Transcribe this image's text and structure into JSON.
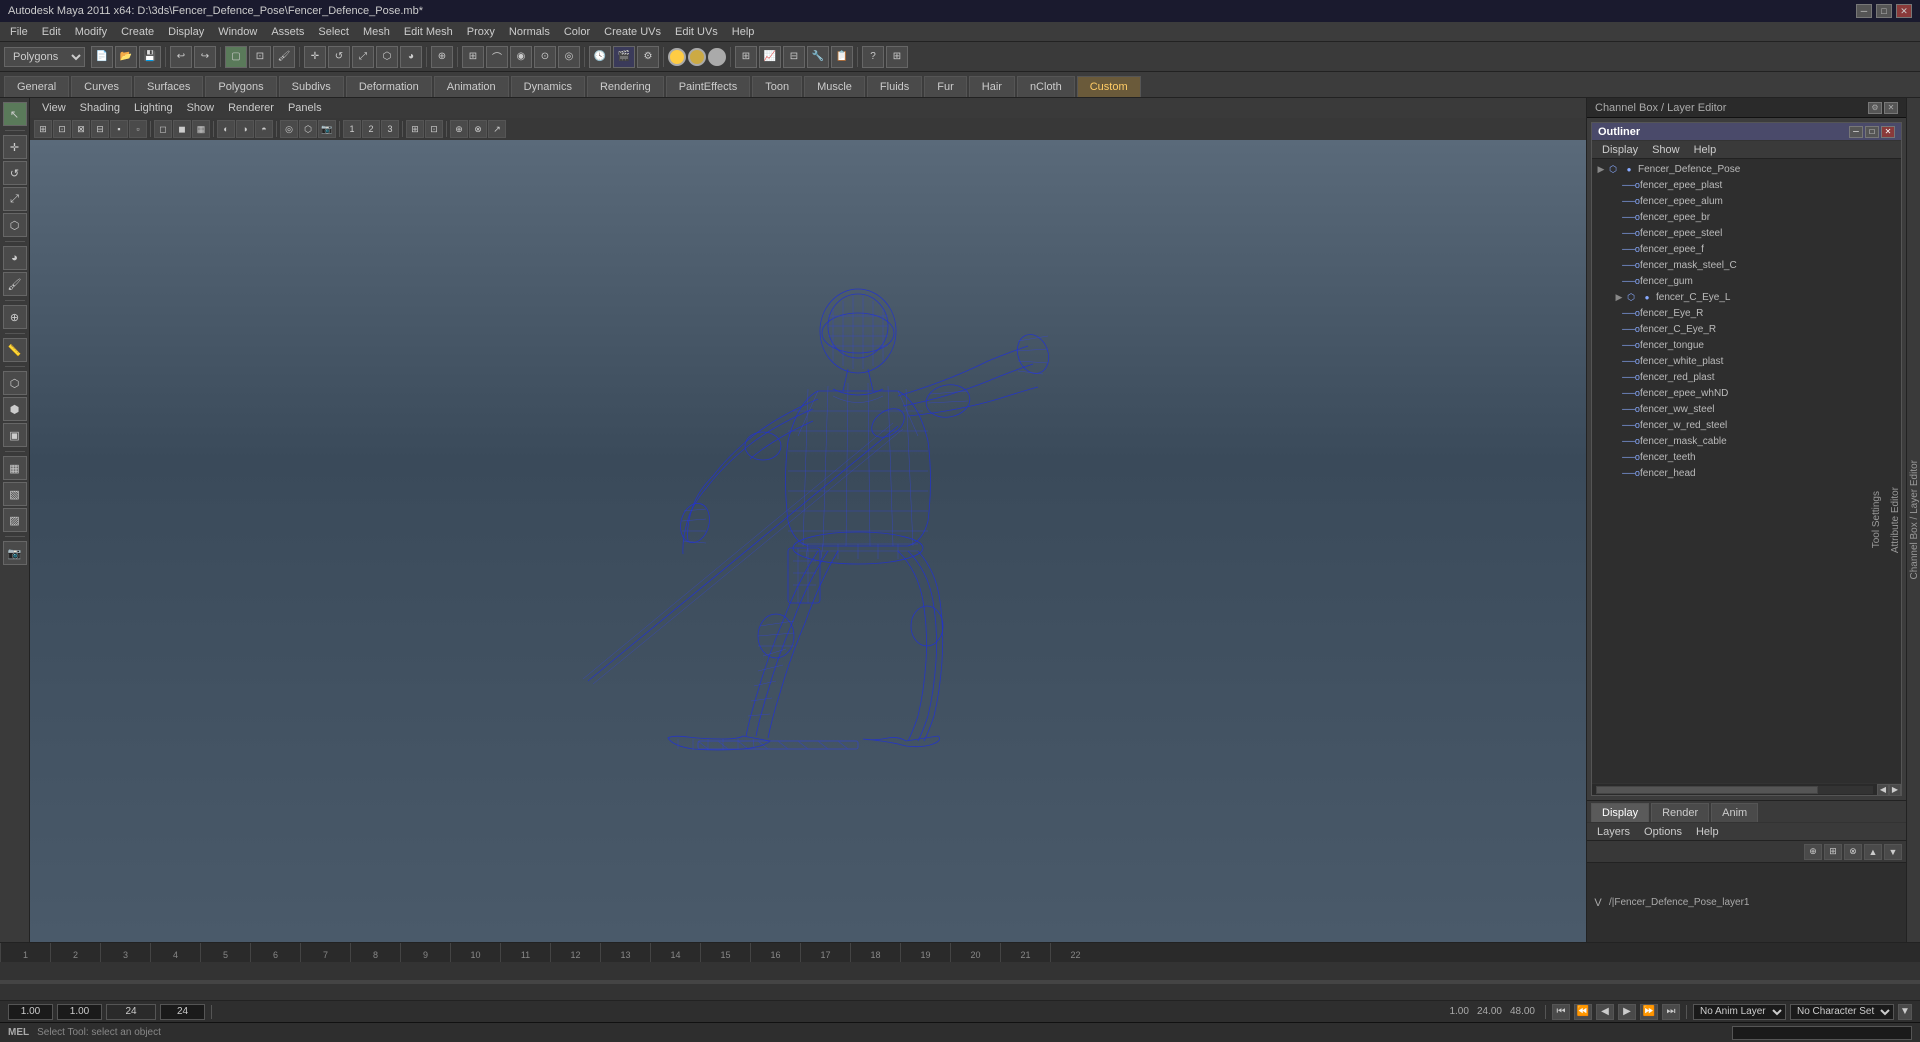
{
  "title_bar": {
    "title": "Autodesk Maya 2011 x64: D:\\3ds\\Fencer_Defence_Pose\\Fencer_Defence_Pose.mb*",
    "min_btn": "─",
    "max_btn": "□",
    "close_btn": "✕"
  },
  "menu_bar": {
    "items": [
      "File",
      "Edit",
      "Modify",
      "Create",
      "Display",
      "Window",
      "Assets",
      "Select",
      "Mesh",
      "Edit Mesh",
      "Proxy",
      "Normals",
      "Color",
      "Create UVs",
      "Edit UVs",
      "Help"
    ]
  },
  "workspace_select": "Polygons",
  "toolbar": {
    "buttons": [
      "⟳",
      "📁",
      "💾",
      "✦",
      "↩",
      "↪",
      "🔧",
      "⚙",
      "🔲",
      "⊞",
      "⊡",
      "△",
      "▽",
      "◁",
      "▷",
      "⬡",
      "⬢",
      "✂",
      "📋",
      "🗑",
      "🔍",
      "🔎",
      "⊕",
      "⊗",
      "↗",
      "↙",
      "⤢",
      "⤡",
      "🎯",
      "◉",
      "⊙",
      "◎",
      "●",
      "○",
      "◐",
      "◑",
      "◒",
      "◓",
      "⬤",
      "▣",
      "▤",
      "▥",
      "▦",
      "▧",
      "▨",
      "▩"
    ]
  },
  "tabs": {
    "items": [
      "General",
      "Curves",
      "Surfaces",
      "Polygons",
      "Subdivs",
      "Deformation",
      "Animation",
      "Dynamics",
      "Rendering",
      "PaintEffects",
      "Toon",
      "Muscle",
      "Fluids",
      "Fur",
      "Hair",
      "nCloth",
      "Custom"
    ]
  },
  "viewport_menu": {
    "items": [
      "View",
      "Shading",
      "Lighting",
      "Show",
      "Renderer",
      "Panels"
    ]
  },
  "viewport_toolbar": {
    "buttons": [
      "⊞",
      "⊟",
      "⊠",
      "⊡",
      "▣",
      "⊕",
      "⬡",
      "⬢",
      "◉",
      "⊙",
      "◎",
      "◐",
      "◑",
      "⬛",
      "⬜",
      "▪",
      "▫",
      "◆",
      "◇",
      "▲",
      "△",
      "▼",
      "▽",
      "◀",
      "▶",
      "⊤",
      "⊥",
      "⋮",
      "⋯",
      "⊸",
      "⊹",
      "⊺",
      "⊻",
      "⊼",
      "⊽"
    ]
  },
  "channel_box": {
    "title": "Channel Box / Layer Editor"
  },
  "outliner": {
    "title": "Outliner",
    "menu": [
      "Display",
      "Show",
      "Help"
    ],
    "items": [
      {
        "name": "Fencer_Defence_Pose",
        "type": "group",
        "icon": "▶",
        "indent": 0,
        "selected": false
      },
      {
        "name": "fencer_epee_plast",
        "type": "mesh",
        "icon": "○",
        "indent": 1,
        "selected": false
      },
      {
        "name": "fencer_epee_alum",
        "type": "mesh",
        "icon": "○",
        "indent": 1,
        "selected": false
      },
      {
        "name": "fencer_epee_br",
        "type": "mesh",
        "icon": "○",
        "indent": 1,
        "selected": false
      },
      {
        "name": "fencer_epee_steel",
        "type": "mesh",
        "icon": "○",
        "indent": 1,
        "selected": false
      },
      {
        "name": "fencer_epee_f",
        "type": "mesh",
        "icon": "○",
        "indent": 1,
        "selected": false
      },
      {
        "name": "fencer_mask_steel_C",
        "type": "mesh",
        "icon": "○",
        "indent": 1,
        "selected": false
      },
      {
        "name": "fencer_gum",
        "type": "mesh",
        "icon": "○",
        "indent": 1,
        "selected": false
      },
      {
        "name": "fencer_C_Eye_L",
        "type": "group",
        "icon": "▶",
        "indent": 1,
        "selected": false
      },
      {
        "name": "fencer_Eye_R",
        "type": "mesh",
        "icon": "○",
        "indent": 1,
        "selected": false
      },
      {
        "name": "fencer_C_Eye_R",
        "type": "mesh",
        "icon": "○",
        "indent": 1,
        "selected": false
      },
      {
        "name": "fencer_tongue",
        "type": "mesh",
        "icon": "○",
        "indent": 1,
        "selected": false
      },
      {
        "name": "fencer_white_plast",
        "type": "mesh",
        "icon": "○",
        "indent": 1,
        "selected": false
      },
      {
        "name": "fencer_red_plast",
        "type": "mesh",
        "icon": "○",
        "indent": 1,
        "selected": false
      },
      {
        "name": "fencer_epee_whND",
        "type": "mesh",
        "icon": "○",
        "indent": 1,
        "selected": false
      },
      {
        "name": "fencer_ww_steel",
        "type": "mesh",
        "icon": "○",
        "indent": 1,
        "selected": false
      },
      {
        "name": "fencer_w_red_steel",
        "type": "mesh",
        "icon": "○",
        "indent": 1,
        "selected": false
      },
      {
        "name": "fencer_mask_cable",
        "type": "mesh",
        "icon": "○",
        "indent": 1,
        "selected": false
      },
      {
        "name": "fencer_teeth",
        "type": "mesh",
        "icon": "○",
        "indent": 1,
        "selected": false
      },
      {
        "name": "fencer_head",
        "type": "mesh",
        "icon": "○",
        "indent": 1,
        "selected": false
      }
    ]
  },
  "layer_tabs": [
    "Display",
    "Render",
    "Anim"
  ],
  "layer_editor": {
    "menu": [
      "Layers",
      "Options",
      "Help"
    ],
    "layer_name": "/|Fencer_Defence_Pose_layer1",
    "v_label": "V"
  },
  "timeline": {
    "ruler_marks": [
      "1",
      "2",
      "3",
      "4",
      "5",
      "6",
      "7",
      "8",
      "9",
      "10",
      "11",
      "12",
      "13",
      "14",
      "15",
      "16",
      "17",
      "18",
      "19",
      "20",
      "21",
      "22"
    ],
    "right_marks": [
      "1.00",
      "24.00",
      "48.00"
    ],
    "current_frame": "1.00",
    "playback_start": "1.00",
    "playback_end": "24",
    "total_end": "24",
    "anim_layer": "No Anim Layer",
    "char_set": "No Character Set"
  },
  "status_bar": {
    "mel_label": "MEL",
    "status_text": "Select Tool: select an object"
  },
  "right_strip": {
    "labels": [
      "Channel Box / Layer Editor",
      "Attribute Editor",
      "Tool Settings"
    ]
  }
}
